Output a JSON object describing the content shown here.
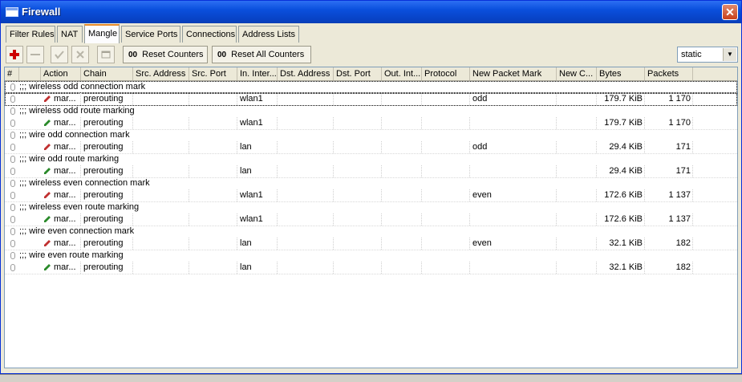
{
  "window": {
    "title": "Firewall",
    "close_label": "✕"
  },
  "tabs": [
    {
      "label": "Filter Rules",
      "active": false
    },
    {
      "label": "NAT",
      "active": false
    },
    {
      "label": "Mangle",
      "active": true
    },
    {
      "label": "Service Ports",
      "active": false
    },
    {
      "label": "Connections",
      "active": false
    },
    {
      "label": "Address Lists",
      "active": false
    }
  ],
  "toolbar": {
    "add_icon": "plus-icon",
    "remove_icon": "minus-icon",
    "enable_icon": "check-icon",
    "disable_icon": "x-icon",
    "comment_icon": "note-icon",
    "reset_counters_label": "Reset Counters",
    "reset_all_counters_label": "Reset All Counters",
    "counter_prefix": "00",
    "filter_value": "static",
    "colors": {
      "add": "#cc0000"
    }
  },
  "columns": [
    "#",
    "Action",
    "Chain",
    "Src. Address",
    "Src. Port",
    "In. Inter...",
    "Dst. Address",
    "Dst. Port",
    "Out. Int...",
    "Protocol",
    "New Packet Mark",
    "New C...",
    "Bytes",
    "Packets"
  ],
  "rules": [
    {
      "comment": ";;; wireless odd connection mark",
      "action": "mar...",
      "action_type": "connection",
      "chain": "prerouting",
      "in_iface": "wlan1",
      "new_packet_mark": "odd",
      "bytes": "179.7 KiB",
      "packets": "1 170"
    },
    {
      "comment": ";;; wireless odd route marking",
      "action": "mar...",
      "action_type": "route",
      "chain": "prerouting",
      "in_iface": "wlan1",
      "new_packet_mark": "",
      "bytes": "179.7 KiB",
      "packets": "1 170"
    },
    {
      "comment": ";;; wire odd connection mark",
      "action": "mar...",
      "action_type": "connection",
      "chain": "prerouting",
      "in_iface": "lan",
      "new_packet_mark": "odd",
      "bytes": "29.4 KiB",
      "packets": "171"
    },
    {
      "comment": ";;; wire odd route marking",
      "action": "mar...",
      "action_type": "route",
      "chain": "prerouting",
      "in_iface": "lan",
      "new_packet_mark": "",
      "bytes": "29.4 KiB",
      "packets": "171"
    },
    {
      "comment": ";;; wireless even connection mark",
      "action": "mar...",
      "action_type": "connection",
      "chain": "prerouting",
      "in_iface": "wlan1",
      "new_packet_mark": "even",
      "bytes": "172.6 KiB",
      "packets": "1 137"
    },
    {
      "comment": ";;; wireless even route marking",
      "action": "mar...",
      "action_type": "route",
      "chain": "prerouting",
      "in_iface": "wlan1",
      "new_packet_mark": "",
      "bytes": "172.6 KiB",
      "packets": "1 137"
    },
    {
      "comment": ";;; wire even connection mark",
      "action": "mar...",
      "action_type": "connection",
      "chain": "prerouting",
      "in_iface": "lan",
      "new_packet_mark": "even",
      "bytes": "32.1 KiB",
      "packets": "182"
    },
    {
      "comment": ";;; wire even route marking",
      "action": "mar...",
      "action_type": "route",
      "chain": "prerouting",
      "in_iface": "lan",
      "new_packet_mark": "",
      "bytes": "32.1 KiB",
      "packets": "182"
    }
  ],
  "colors": {
    "connection_pen": "#c03030",
    "route_pen": "#2a8a2a",
    "title_bar": "#0a4fdc",
    "active_tab_accent": "#e68b2c"
  }
}
